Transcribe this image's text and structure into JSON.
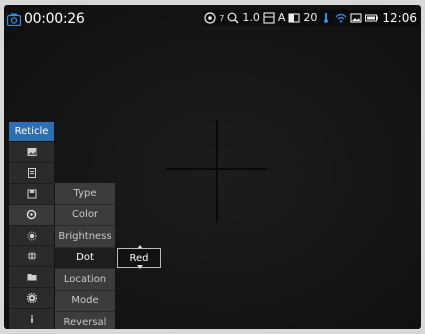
{
  "status_bar": {
    "recording_time": "00:00:26",
    "wifi_signal_count": "7",
    "zoom": "1.0",
    "auto_mode": "A",
    "brightness_level": "20",
    "clock": "12:06"
  },
  "menu": {
    "title": "Reticle",
    "submenu": [
      {
        "label": "Type"
      },
      {
        "label": "Color"
      },
      {
        "label": "Brightness"
      },
      {
        "label": "Dot"
      },
      {
        "label": "Location"
      },
      {
        "label": "Mode"
      },
      {
        "label": "Reversal"
      }
    ],
    "selected_value": "Red"
  },
  "colors": {
    "accent": "#2e6fb4",
    "wifi": "#2e8fe0",
    "background": "#141414"
  },
  "icons": [
    "camera-icon",
    "settings-icon",
    "zoom-icon",
    "photo-mode-icon",
    "brightness-icon",
    "thermometer-icon",
    "wifi-icon",
    "image-icon",
    "battery-icon",
    "reticle-icon",
    "crosshair-icon",
    "sun-icon",
    "globe-icon",
    "folder-icon",
    "gear-icon",
    "info-icon"
  ]
}
